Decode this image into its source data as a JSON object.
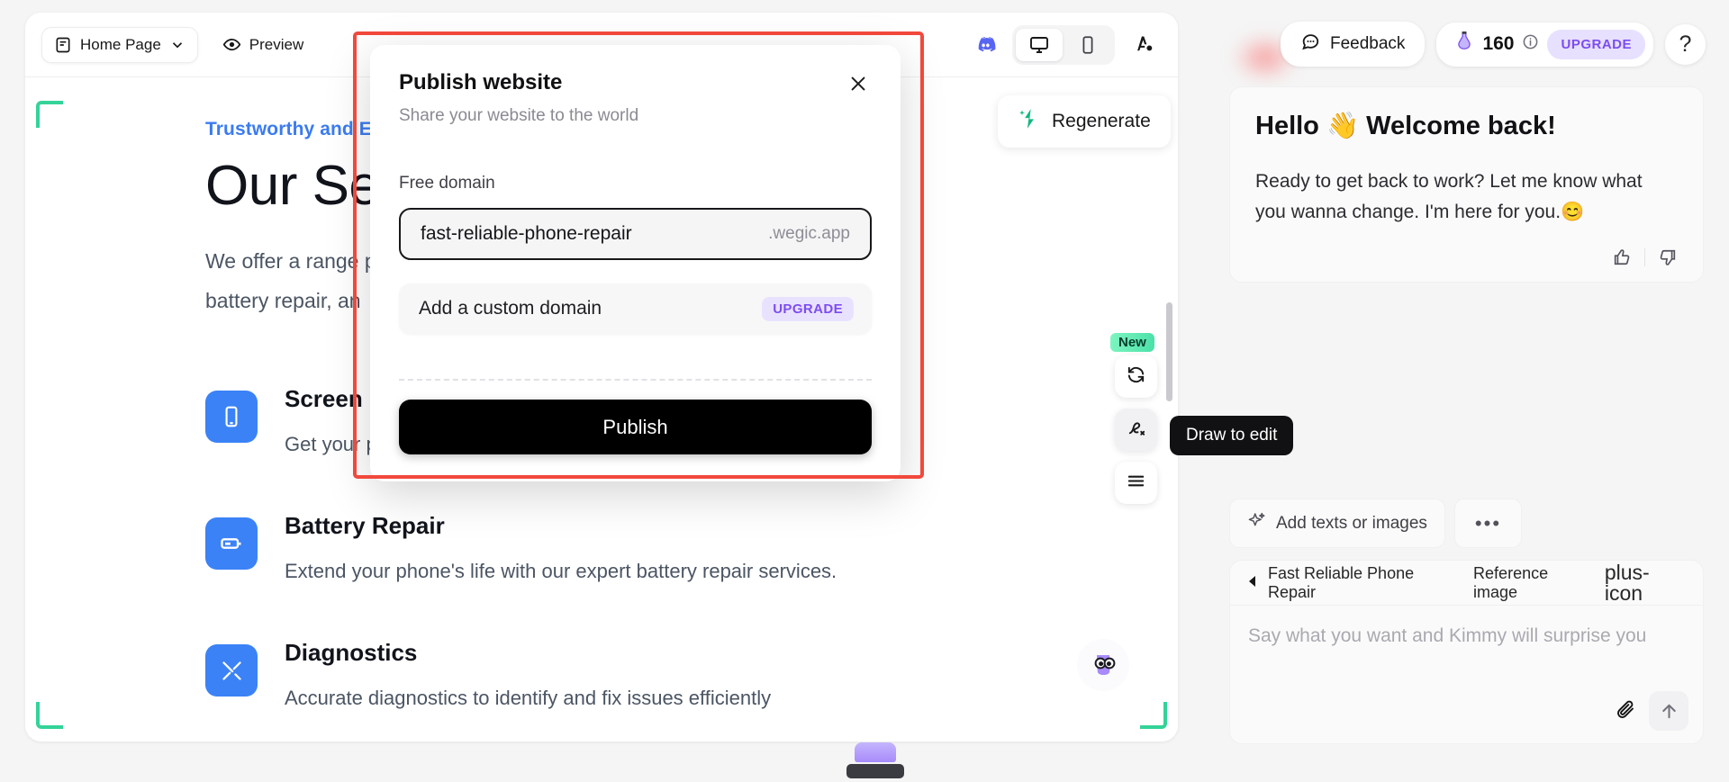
{
  "editor": {
    "page_selector": {
      "label": "Home Page",
      "icon": "page-icon",
      "caret": "chevron-down-icon"
    },
    "preview": {
      "label": "Preview",
      "icon": "eye-icon"
    },
    "discord_icon": "discord-icon",
    "device_desktop_icon": "desktop-icon",
    "device_mobile_icon": "mobile-icon",
    "typography_icon": "typography-icon",
    "regenerate": {
      "label": "Regenerate",
      "icon": "sparkle-wand-icon"
    }
  },
  "site": {
    "eyebrow": "Trustworthy and Eff",
    "heading": "Our Servi",
    "paragraph_line1": "We offer a range                              placement,",
    "paragraph_line2": "battery repair, an",
    "services": [
      {
        "icon": "phone-screen-icon",
        "title": "Screen Rep",
        "desc": "Get your phone screen repaired with high-quality parts"
      },
      {
        "icon": "battery-icon",
        "title": "Battery Repair",
        "desc": "Extend your phone's life with our expert battery repair services."
      },
      {
        "icon": "tools-icon",
        "title": "Diagnostics",
        "desc": "Accurate diagnostics to identify and fix issues efficiently"
      }
    ]
  },
  "modal": {
    "title": "Publish website",
    "subtitle": "Share your website to the world",
    "close_icon": "close-icon",
    "free_domain_label": "Free domain",
    "domain_value": "fast-reliable-phone-repair",
    "domain_suffix": ".wegic.app",
    "custom_domain_label": "Add a custom domain",
    "custom_domain_badge": "UPGRADE",
    "publish_label": "Publish"
  },
  "rail": {
    "new_badge": "New",
    "refresh_icon": "refresh-icon",
    "draw_icon": "draw-edit-icon",
    "menu_icon": "menu-icon",
    "tooltip": "Draw to edit"
  },
  "chat": {
    "feedback": {
      "label": "Feedback",
      "icon": "chat-bubble-icon"
    },
    "credits": {
      "icon": "potion-icon",
      "value": "160",
      "info_icon": "info-icon",
      "upgrade_label": "UPGRADE"
    },
    "help_icon": "?",
    "greeting_title": "Hello 👋 Welcome back!",
    "greeting_body": "Ready to get back to work? Let me know what you wanna change. I'm here for you.😊",
    "thumbs_up_icon": "thumbs-up-icon",
    "thumbs_down_icon": "thumbs-down-icon",
    "quick_actions": [
      {
        "label": "Add texts or images",
        "icon": "sparkle-icon"
      },
      {
        "label": "•••",
        "icon": "more-icon"
      }
    ],
    "composer": {
      "back_icon": "back-triangle-icon",
      "project_name": "Fast Reliable Phone Repair",
      "reference_label": "Reference image",
      "add_icon": "plus-icon",
      "placeholder": "Say what you want and Kimmy will surprise you",
      "attach_icon": "paperclip-icon",
      "send_icon": "arrow-up-icon"
    }
  },
  "colors": {
    "accent_purple": "#7c4df0",
    "highlight_red": "#f1483c",
    "brand_blue": "#3b82f6",
    "green": "#34d399"
  }
}
